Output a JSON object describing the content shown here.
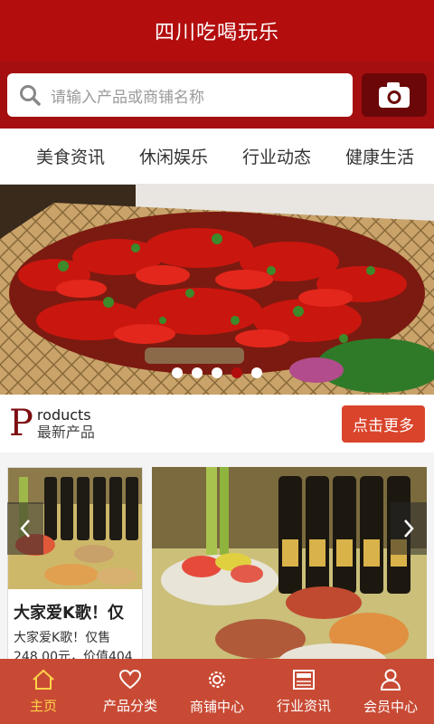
{
  "app": {
    "title": "四川吃喝玩乐"
  },
  "search": {
    "placeholder": "请输入产品或商铺名称"
  },
  "tabs": [
    {
      "label": "美食资讯"
    },
    {
      "label": "休闲娱乐"
    },
    {
      "label": "行业动态"
    },
    {
      "label": "健康生活"
    }
  ],
  "banner": {
    "slide_count": 5,
    "active_slide": 4
  },
  "products_section": {
    "heading_letter": "P",
    "heading_en": "roducts",
    "heading_cn": "最新产品",
    "more_label": "点击更多"
  },
  "products": [
    {
      "title": "大家爱K歌！仅",
      "desc": "大家爱K歌！仅售248.00元，价值404"
    }
  ],
  "bottom_nav": [
    {
      "label": "主页",
      "icon": "home-icon",
      "active": true
    },
    {
      "label": "产品分类",
      "icon": "heart-icon",
      "active": false
    },
    {
      "label": "商铺中心",
      "icon": "gear-icon",
      "active": false
    },
    {
      "label": "行业资讯",
      "icon": "news-icon",
      "active": false
    },
    {
      "label": "会员中心",
      "icon": "user-icon",
      "active": false
    }
  ],
  "colors": {
    "header": "#b30d0d",
    "search_bar": "#a50f10",
    "accent": "#d9442b",
    "nav": "#c84a34",
    "nav_active": "#ffd34a"
  }
}
